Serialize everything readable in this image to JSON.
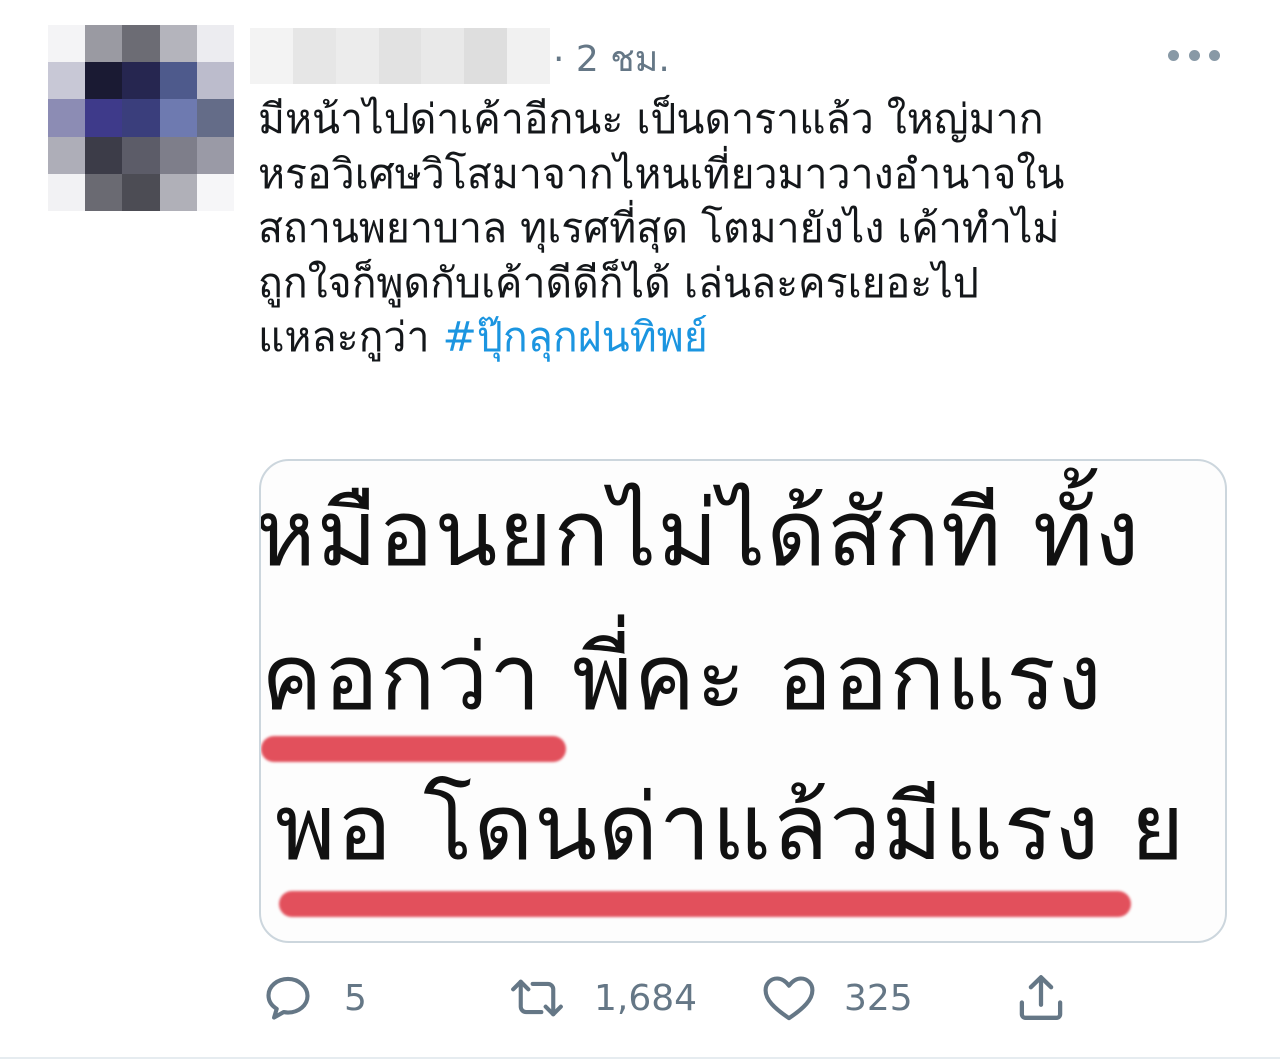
{
  "tweet": {
    "timestamp": "· 2 ชม.",
    "body_text": "มีหน้าไปด่าเค้าอีกนะ เป็นดาราแล้ว ใหญ่มาก\nหรอวิเศษวิโสมาจากไหนเที่ยวมาวางอำนาจใน\nสถานพยาบาล ทุเรศที่สุด โตมายังไง เค้าทำไม่\nถูกใจก็พูดกับเค้าดีดีก็ได้ เล่นละครเยอะไป\nแหละกูว่า  ",
    "hashtag": "#ปุ๊กลุกฝนทิพย์",
    "hashtag_color": "#1b95e0"
  },
  "media": {
    "line1": "หมือนยกไม่ได้สักที ทั้ง",
    "line2": "คอกว่า พี่คะ ออกแรง",
    "line3": "พอ โดนด่าแล้วมีแรง ย",
    "underline_color": "#e0424f"
  },
  "actions": {
    "reply_icon": "reply-icon",
    "reply_count": "5",
    "retweet_icon": "retweet-icon",
    "retweet_count": "1,684",
    "like_icon": "heart-icon",
    "like_count": "325",
    "share_icon": "share-icon"
  },
  "colors": {
    "secondary_text": "#657786",
    "border": "#ccd6dd"
  }
}
